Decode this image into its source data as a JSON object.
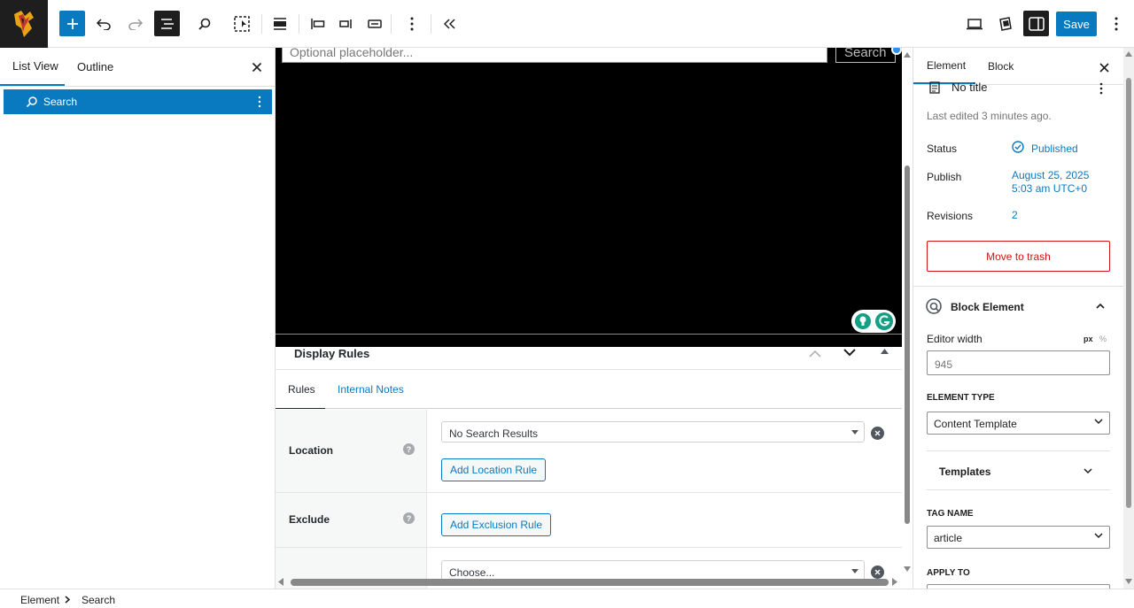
{
  "toolbar": {
    "save_label": "Save",
    "icons": [
      "add-block-icon",
      "undo-icon",
      "redo-icon",
      "document-overview-icon",
      "search-icon",
      "select-mode-icon",
      "align-icon",
      "justify-left-icon",
      "justify-center-icon",
      "justify-space-icon",
      "more-vertical-icon",
      "collapse-icon",
      "preview-desktop-icon",
      "styles-icon",
      "settings-sidebar-icon",
      "options-icon"
    ],
    "accent": "#0a7ac0"
  },
  "left_panel": {
    "tabs": [
      {
        "label": "List View"
      },
      {
        "label": "Outline"
      }
    ],
    "items": [
      {
        "label": "Search"
      }
    ]
  },
  "canvas": {
    "input_placeholder": "Optional placeholder...",
    "search_button": "Search"
  },
  "display_rules": {
    "title": "Display Rules",
    "tabs": [
      {
        "label": "Rules"
      },
      {
        "label": "Internal Notes"
      }
    ],
    "rows": [
      {
        "label": "Location",
        "help": "?",
        "select_value": "No Search Results",
        "button": "Add Location Rule"
      },
      {
        "label": "Exclude",
        "help": "?",
        "button": "Add Exclusion Rule"
      },
      {
        "select_value": "Choose..."
      }
    ]
  },
  "right_panel": {
    "tabs": [
      {
        "label": "Element"
      },
      {
        "label": "Block"
      }
    ],
    "doc_title": "No title",
    "last_edited": "Last edited 3 minutes ago.",
    "status_label": "Status",
    "status_value": "Published",
    "publish_label": "Publish",
    "publish_date": "August 25, 2025",
    "publish_time": "5:03 am UTC+0",
    "revisions_label": "Revisions",
    "revisions_value": "2",
    "trash_label": "Move to trash",
    "section_title": "Block Element",
    "editor_width_label": "Editor width",
    "unit_px": "px",
    "unit_pct": "%",
    "editor_width_placeholder": "945",
    "element_type_label": "ELEMENT TYPE",
    "element_type_value": "Content Template",
    "templates_label": "Templates",
    "tag_name_label": "TAG NAME",
    "tag_name_value": "article",
    "apply_to_label": "APPLY TO"
  },
  "breadcrumb": {
    "items": [
      "Element",
      "Search"
    ]
  }
}
